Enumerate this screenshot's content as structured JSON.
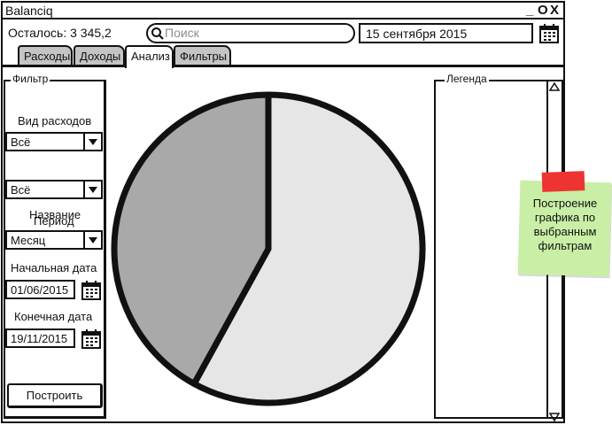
{
  "window": {
    "title": "Balanciq",
    "controls": {
      "minimize": "_",
      "maximize": "O",
      "close": "X"
    }
  },
  "header": {
    "remaining": "Осталось: 3 345,2",
    "search_placeholder": "Поиск",
    "date": "15 сентября 2015"
  },
  "tabs": [
    {
      "label": "Расходы",
      "active": false
    },
    {
      "label": "Доходы",
      "active": false
    },
    {
      "label": "Анализ",
      "active": true
    },
    {
      "label": "Фильтры",
      "active": false
    }
  ],
  "filter": {
    "title": "Фильтр",
    "expense_type_label": "Вид расходов",
    "expense_type_value": "Всё",
    "name_value": "Всё",
    "name_label": "Название",
    "period_label": "Период",
    "period_value": "Месяц",
    "start_date_label": "Начальная дата",
    "start_date_value": "01/06/2015",
    "end_date_label": "Конечная дата",
    "end_date_value": "19/11/2015",
    "build_button": "Построить"
  },
  "chart_data": {
    "type": "pie",
    "values": [
      58,
      42
    ],
    "colors": [
      "#e6e6e6",
      "#a9a9a9"
    ]
  },
  "legend": {
    "title": "Легенда"
  },
  "sticky_note": {
    "text": "Построение графика по выбранным фильтрам",
    "color": "#c9efa6"
  }
}
